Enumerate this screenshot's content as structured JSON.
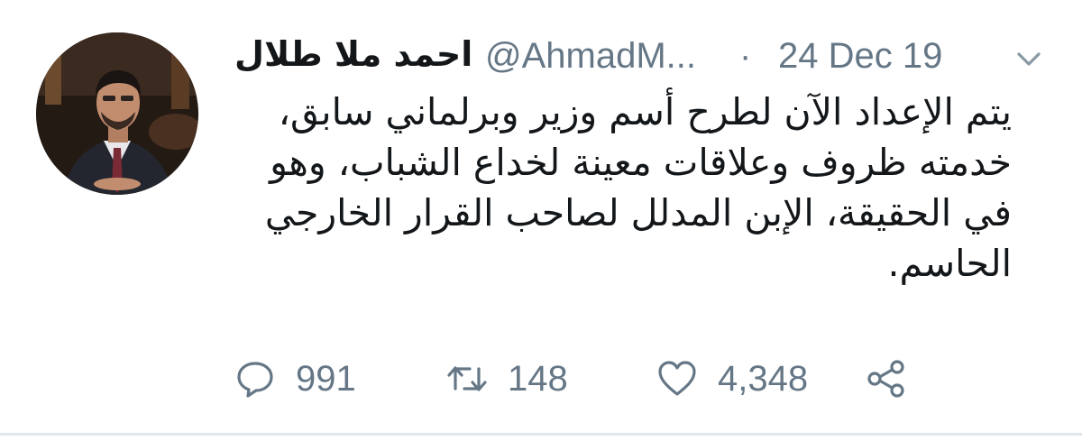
{
  "tweet": {
    "author": {
      "name": "احمد ملا طلال",
      "handle": "@AhmadM...",
      "avatar_icon": "profile-photo"
    },
    "date_separator": "·",
    "date": "24 Dec 19",
    "menu_icon": "chevron-down-icon",
    "text_lines": [
      "يتم الإعداد الآن لطرح أسم  وزير وبرلماني سابق،",
      "خدمته ظروف وعلاقات معينة لخداع الشباب، وهو",
      "في الحقيقة، الإبن المدلل لصاحب القرار الخارجي",
      "الحاسم."
    ],
    "actions": {
      "reply_count": "991",
      "retweet_count": "148",
      "like_count": "4,348"
    }
  },
  "colors": {
    "primary_text": "#14171a",
    "secondary_text": "#657786",
    "divider": "#e1e8ed"
  }
}
